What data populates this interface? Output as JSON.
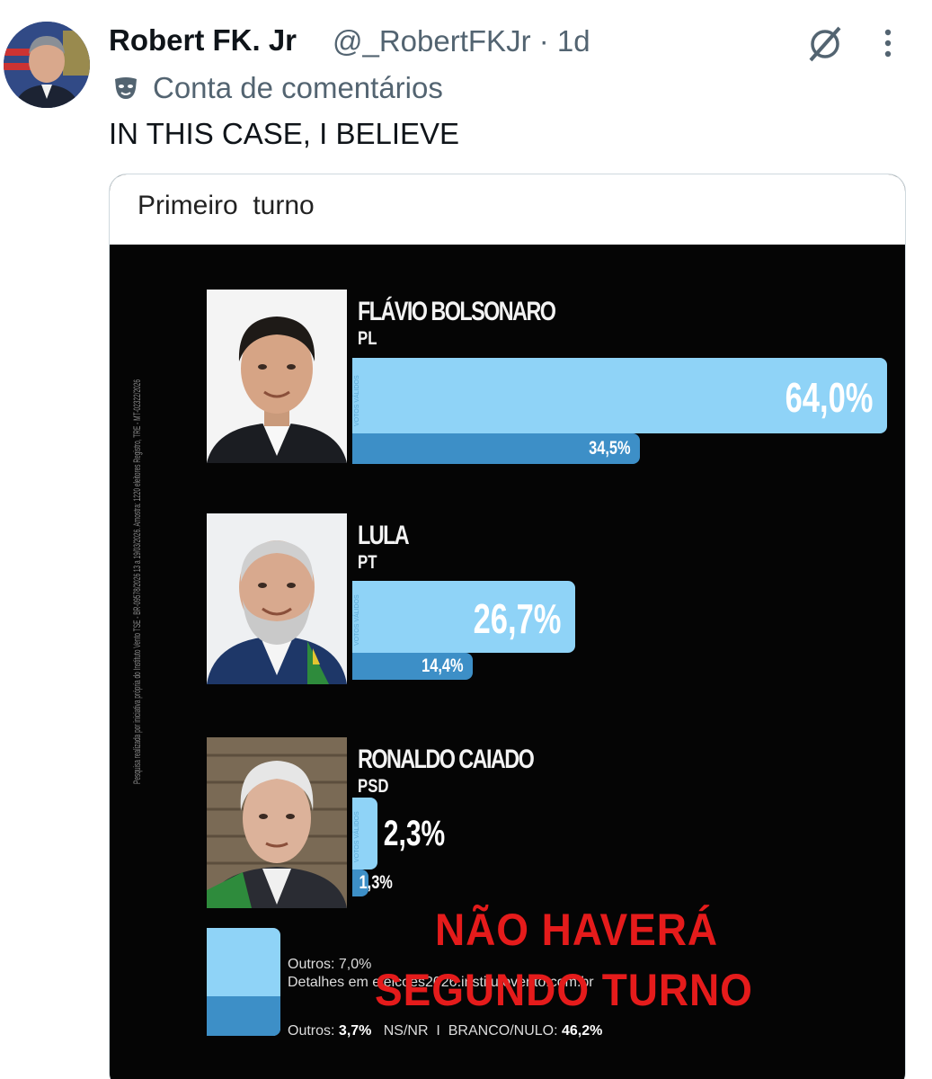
{
  "post": {
    "author_name": "Robert FK. Jr",
    "handle_time": "@_RobertFKJr · 1d",
    "community_label": "Conta de comentários",
    "text": "IN THIS CASE, I BELIEVE"
  },
  "media": {
    "title": "Primeiro  turno",
    "side_note": "Pesquisa realizada por iniciativa própria do Instituto Vento TSE - BR-09578/2026 13 a 19/03/2026. Amostra: 1220 eleitores Registro, TRE - MT-02322/2026",
    "bar_tag": "VOTOS VÁLIDOS",
    "candidates": [
      {
        "name": "FLÁVIO BOLSONARO",
        "party": "PL",
        "main_pct": "64,0%",
        "sub_pct": "34,5%",
        "main_value": 64.0,
        "sub_value": 34.5
      },
      {
        "name": "LULA",
        "party": "PT",
        "main_pct": "26,7%",
        "sub_pct": "14,4%",
        "main_value": 26.7,
        "sub_value": 14.4
      },
      {
        "name": "RONALDO CAIADO",
        "party": "PSD",
        "main_pct": "2,3%",
        "sub_pct": "1,3%",
        "main_value": 2.3,
        "sub_value": 1.3
      }
    ],
    "outros_valid": "Outros: 7,0%",
    "detalhes": "Detalhes em eleicoes2026.institutovento.com.br",
    "footer": {
      "outros_label": "Outros:",
      "outros_value": "3,7%",
      "nsnr": "NS/NR",
      "sep": "I",
      "branco_label": "BRANCO/NULO:",
      "branco_value": "46,2%"
    },
    "overlay_line1": "NÃO HAVERÁ",
    "overlay_line2": "SEGUNDO TURNO"
  },
  "colors": {
    "bar_light": "#8fd3f7",
    "bar_dark": "#3d8fc7",
    "overlay_red": "#e51b1b"
  }
}
